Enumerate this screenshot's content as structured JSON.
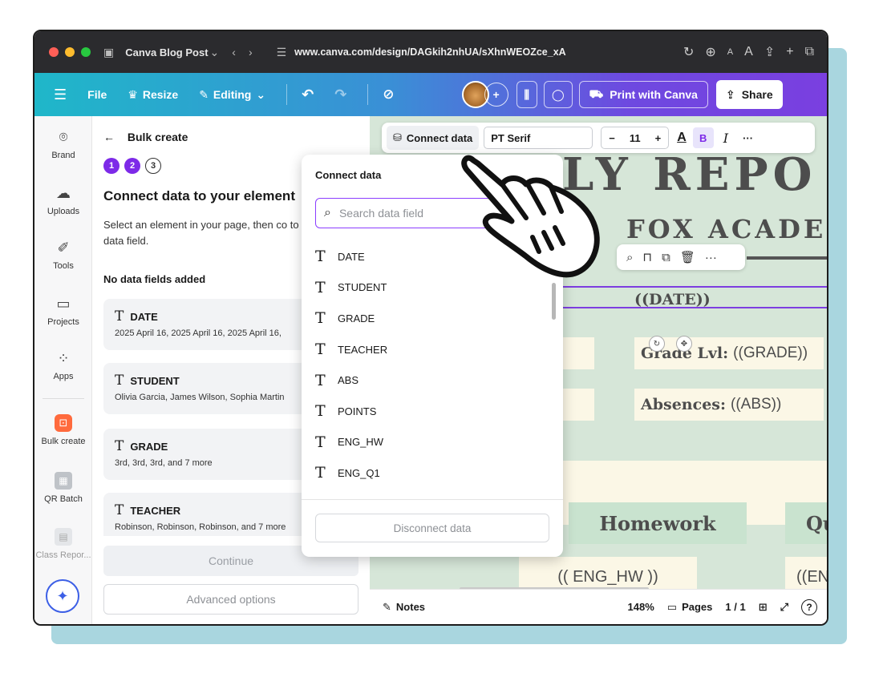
{
  "browser": {
    "tab_title": "Canva Blog Post",
    "url": "www.canva.com/design/DAGkih2nhUA/sXhnWEOZce_xA"
  },
  "canva_toolbar": {
    "file": "File",
    "resize": "Resize",
    "editing": "Editing",
    "print": "Print with Canva",
    "share": "Share"
  },
  "rail": {
    "items": [
      {
        "label": "Brand",
        "icon": "brand-icon"
      },
      {
        "label": "Uploads",
        "icon": "upload-icon"
      },
      {
        "label": "Tools",
        "icon": "tools-icon"
      },
      {
        "label": "Projects",
        "icon": "folder-icon"
      },
      {
        "label": "Apps",
        "icon": "apps-icon"
      },
      {
        "label": "Bulk create",
        "icon": "bulk-create-icon"
      },
      {
        "label": "QR Batch",
        "icon": "qr-icon"
      },
      {
        "label": "Class Repor...",
        "icon": "class-report-icon"
      }
    ]
  },
  "panel": {
    "back_label": "Bulk create",
    "steps": [
      "1",
      "2",
      "3"
    ],
    "title": "Connect data to your element",
    "description": "Select an element in your page, then co to a data field.",
    "no_fields": "No data fields added",
    "fields": [
      {
        "name": "DATE",
        "values": "2025 April 16, 2025 April 16, 2025 April 16,"
      },
      {
        "name": "STUDENT",
        "values": "Olivia Garcia, James Wilson, Sophia Martin"
      },
      {
        "name": "GRADE",
        "values": "3rd, 3rd, 3rd, and 7 more"
      },
      {
        "name": "TEACHER",
        "values": "Robinson, Robinson, Robinson, and 7 more"
      }
    ],
    "continue": "Continue",
    "advanced": "Advanced options"
  },
  "format_toolbar": {
    "connect_data": "Connect data",
    "font": "PT Serif",
    "size_minus": "−",
    "size": "11",
    "size_plus": "+",
    "bold": "B",
    "italic": "I",
    "more": "···"
  },
  "document": {
    "title": "LY REPO",
    "subtitle": "FOX ACADEM",
    "date_placeholder": "((DATE))",
    "grade_label": "Grade Lvl:",
    "grade_placeholder": "((GRADE))",
    "absences_label": "Absences:",
    "absences_placeholder": "((ABS))",
    "homework_header": "Homework",
    "quiz_header_partial": "Qu",
    "eng_hw_cell": "(( ENG_HW ))",
    "eng_cell_partial": "((EN"
  },
  "dropdown": {
    "title": "Connect data",
    "search_placeholder": "Search data field",
    "items": [
      "DATE",
      "STUDENT",
      "GRADE",
      "TEACHER",
      "ABS",
      "POINTS",
      "ENG_HW",
      "ENG_Q1"
    ],
    "disconnect": "Disconnect data"
  },
  "bottom_bar": {
    "notes": "Notes",
    "zoom": "148%",
    "pages": "Pages",
    "page_count": "1 / 1"
  },
  "colors": {
    "accent": "#7d2ae8",
    "canvas_bg": "#d6e6d8",
    "cream": "#fbf7e6"
  }
}
